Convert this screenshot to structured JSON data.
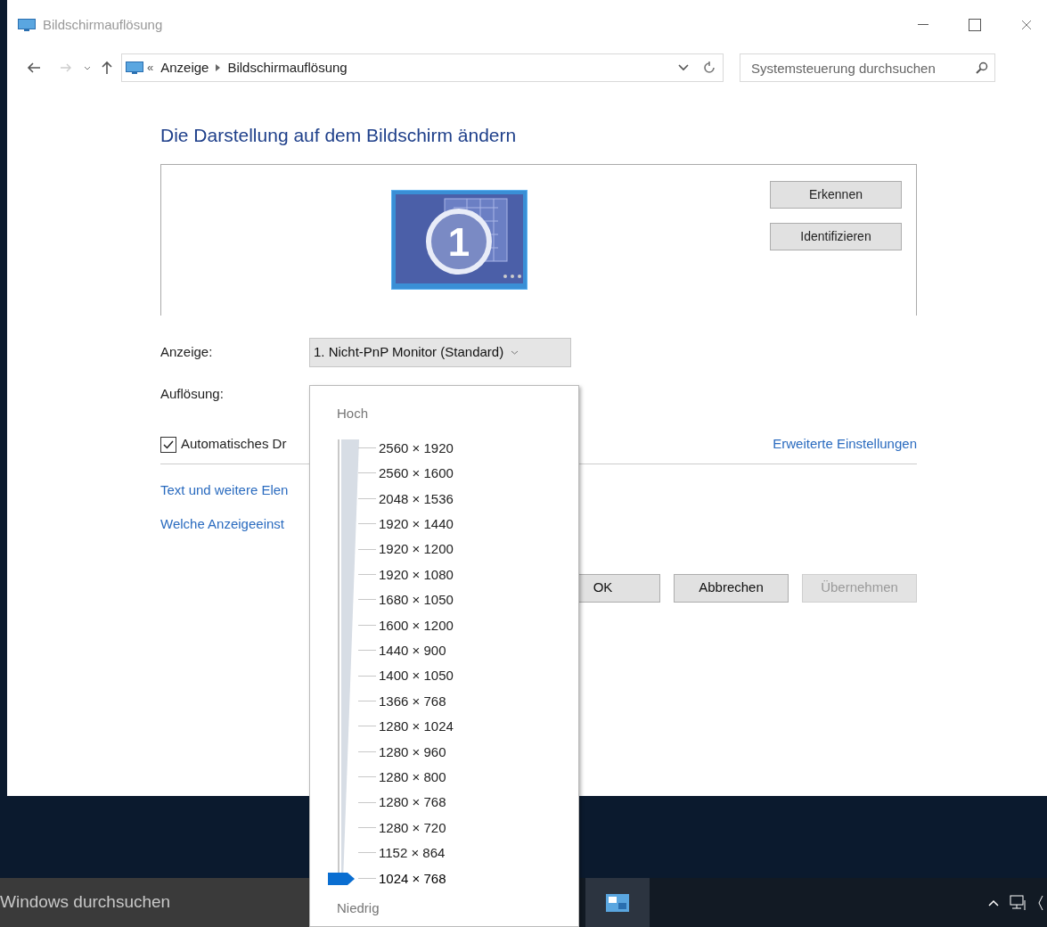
{
  "window": {
    "title": "Bildschirmauflösung"
  },
  "address_bar": {
    "overflow": "«",
    "breadcrumb": [
      "Anzeige",
      "Bildschirmauflösung"
    ]
  },
  "search": {
    "placeholder": "Systemsteuerung durchsuchen"
  },
  "heading": "Die Darstellung auf dem Bildschirm ändern",
  "monitor_preview": {
    "number": "1",
    "buttons": [
      "Erkennen",
      "Identifizieren"
    ]
  },
  "display_row": {
    "label": "Anzeige:",
    "value": "1. Nicht-PnP Monitor (Standard)"
  },
  "resolution_row": {
    "label": "Auflösung:"
  },
  "auto_rotate": {
    "label": "Automatisches Dr",
    "checked": true
  },
  "advanced_link": "Erweiterte Einstellungen",
  "links": [
    "Text und weitere Elen",
    "Welche Anzeigeeinst"
  ],
  "buttons": [
    {
      "label": "OK",
      "disabled": false
    },
    {
      "label": "Abbrechen",
      "disabled": false
    },
    {
      "label": "Übernehmen",
      "disabled": true
    }
  ],
  "resolution_popup": {
    "high_label": "Hoch",
    "low_label": "Niedrig",
    "options": [
      {
        "label": "2560 × 1920",
        "selected": false
      },
      {
        "label": "2560 × 1600",
        "selected": false
      },
      {
        "label": "2048 × 1536",
        "selected": false
      },
      {
        "label": "1920 × 1440",
        "selected": false
      },
      {
        "label": "1920 × 1200",
        "selected": false
      },
      {
        "label": "1920 × 1080",
        "selected": false
      },
      {
        "label": "1680 × 1050",
        "selected": false
      },
      {
        "label": "1600 × 1200",
        "selected": false
      },
      {
        "label": "1440 × 900",
        "selected": false
      },
      {
        "label": "1400 × 1050",
        "selected": false
      },
      {
        "label": "1366 × 768",
        "selected": false
      },
      {
        "label": "1280 × 1024",
        "selected": false
      },
      {
        "label": "1280 × 960",
        "selected": false
      },
      {
        "label": "1280 × 800",
        "selected": false
      },
      {
        "label": "1280 × 768",
        "selected": false
      },
      {
        "label": "1280 × 720",
        "selected": false
      },
      {
        "label": "1152 × 864",
        "selected": false
      },
      {
        "label": "1024 × 768",
        "selected": true
      }
    ]
  },
  "taskbar": {
    "search_placeholder": "Windows durchsuchen"
  }
}
